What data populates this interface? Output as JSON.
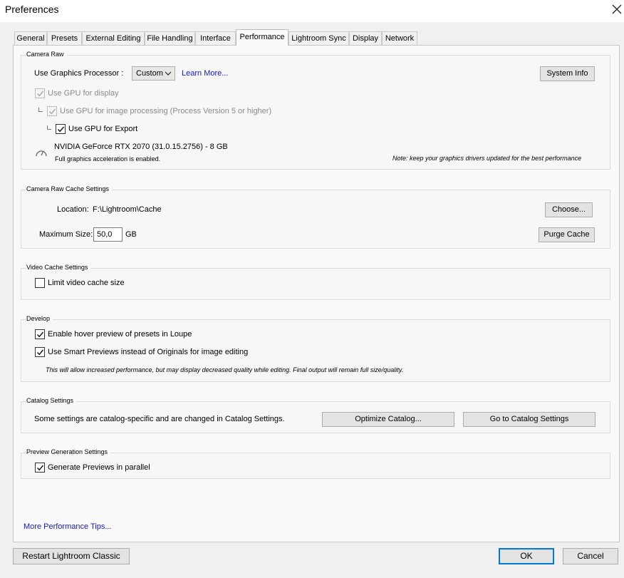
{
  "window": {
    "title": "Preferences"
  },
  "tabs": [
    {
      "label": "General"
    },
    {
      "label": "Presets"
    },
    {
      "label": "External Editing"
    },
    {
      "label": "File Handling"
    },
    {
      "label": "Interface"
    },
    {
      "label": "Performance"
    },
    {
      "label": "Lightroom Sync"
    },
    {
      "label": "Display"
    },
    {
      "label": "Network"
    }
  ],
  "camera_raw": {
    "title": "Camera Raw",
    "gpu_label": "Use Graphics Processor :",
    "gpu_selected": "Custom",
    "learn_more": "Learn More...",
    "system_info": "System Info",
    "use_gpu_display": "Use GPU for display",
    "use_gpu_processing": "Use GPU for image processing (Process Version 5 or higher)",
    "use_gpu_export": "Use GPU for Export",
    "gpu_name": "NVIDIA GeForce RTX 2070 (31.0.15.2756) - 8 GB",
    "accel_status": "Full graphics acceleration is enabled.",
    "driver_note": "Note: keep your graphics drivers updated for the best performance"
  },
  "cache": {
    "title": "Camera Raw Cache Settings",
    "location_label": "Location:",
    "location_value": "F:\\Lightroom\\Cache",
    "choose": "Choose...",
    "max_size_label": "Maximum Size:",
    "max_size_value": "50,0",
    "unit": "GB",
    "purge": "Purge Cache"
  },
  "video_cache": {
    "title": "Video Cache Settings",
    "limit": "Limit video cache size"
  },
  "develop": {
    "title": "Develop",
    "hover_preview": "Enable hover preview of presets in Loupe",
    "smart_previews": "Use Smart Previews instead of Originals for image editing",
    "note": "This will allow increased performance, but may display decreased quality while editing. Final output will remain full size/quality."
  },
  "catalog": {
    "title": "Catalog Settings",
    "desc": "Some settings are catalog-specific and are changed in Catalog Settings.",
    "optimize": "Optimize Catalog...",
    "goto": "Go to Catalog Settings"
  },
  "preview_gen": {
    "title": "Preview Generation Settings",
    "parallel": "Generate Previews in parallel"
  },
  "footer": {
    "tips": "More Performance Tips...",
    "restart": "Restart Lightroom Classic",
    "ok": "OK",
    "cancel": "Cancel"
  },
  "colors": {
    "accent": "#0078d7",
    "link": "#1a1ab8"
  },
  "icons": [
    "close-icon",
    "chevron-down-icon",
    "checkmark-icon",
    "gauge-icon"
  ]
}
